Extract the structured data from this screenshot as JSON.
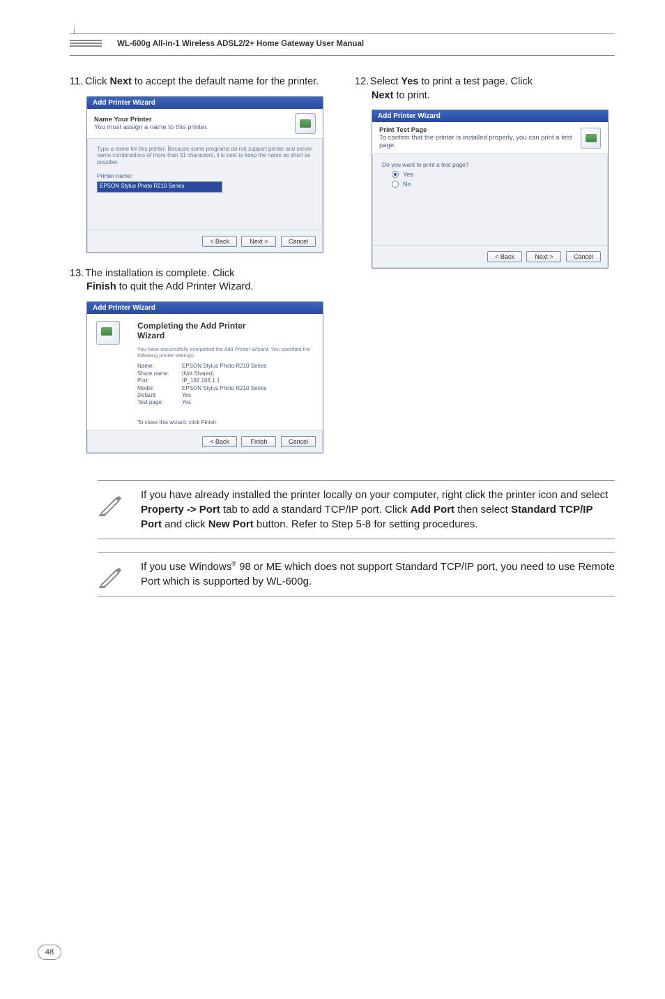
{
  "header": {
    "title": "WL-600g All-in-1 Wireless ADSL2/2+ Home Gateway User Manual"
  },
  "steps": {
    "s11": {
      "num": "11.",
      "before": "Click ",
      "bold": "Next",
      "after": " to accept the default name for the printer."
    },
    "s12": {
      "num": "12.",
      "before": "Select ",
      "bold1": "Yes",
      "mid": " to print a test page. Click ",
      "bold2": "Next",
      "after": " to print."
    },
    "s13": {
      "num": "13.",
      "before": "The installation is complete. Click ",
      "bold": "Finish",
      "after": " to quit the Add Printer Wizard."
    }
  },
  "wiz_common": {
    "title": "Add Printer Wizard",
    "btn_back": "< Back",
    "btn_next": "Next >",
    "btn_cancel": "Cancel",
    "btn_finish": "Finish"
  },
  "wiz11": {
    "head_bold": "Name Your Printer",
    "head_sub": "You must assign a name to this printer.",
    "desc": "Type a name for this printer. Because some programs do not support printer and server name combinations of more than 31 characters, it is best to keep the name as short as possible.",
    "label": "Printer name:",
    "value": "EPSON Stylus Photo R210 Series"
  },
  "wiz12": {
    "head_bold": "Print Test Page",
    "head_sub": "To confirm that the printer is installed properly, you can print a test page.",
    "question": "Do you want to print a test page?",
    "opt_yes": "Yes",
    "opt_no": "No"
  },
  "wiz13": {
    "title_line1": "Completing the Add Printer",
    "title_line2": "Wizard",
    "sub": "You have successfully completed the Add Printer Wizard. You specified the following printer settings:",
    "rows": [
      {
        "k": "Name:",
        "v": "EPSON Stylus Photo R210 Series"
      },
      {
        "k": "Share name:",
        "v": "(Not Shared)"
      },
      {
        "k": "Port:",
        "v": "IP_192.168.1.1"
      },
      {
        "k": "Model:",
        "v": "EPSON Stylus Photo R210 Series"
      },
      {
        "k": "Default:",
        "v": "Yes"
      },
      {
        "k": "Test page:",
        "v": "Yes"
      }
    ],
    "closing": "To close this wizard, click Finish."
  },
  "notes": {
    "n1_a": "If you have already installed the printer locally on your computer, right click the printer icon and select ",
    "n1_b": "Property -> Port",
    "n1_c": " tab to add a standard TCP/IP port. Click ",
    "n1_d": "Add Port",
    "n1_e": " then select ",
    "n1_f": "Standard TCP/IP Port",
    "n1_g": " and click ",
    "n1_h": "New Port",
    "n1_i": " button. Refer to Step 5-8 for setting procedures.",
    "n2_a": "If you use Windows",
    "n2_sup": "®",
    "n2_b": " 98 or ME which does not support Standard TCP/IP port, you need to use Remote Port which is supported by WL-600g."
  },
  "page_number": "48"
}
